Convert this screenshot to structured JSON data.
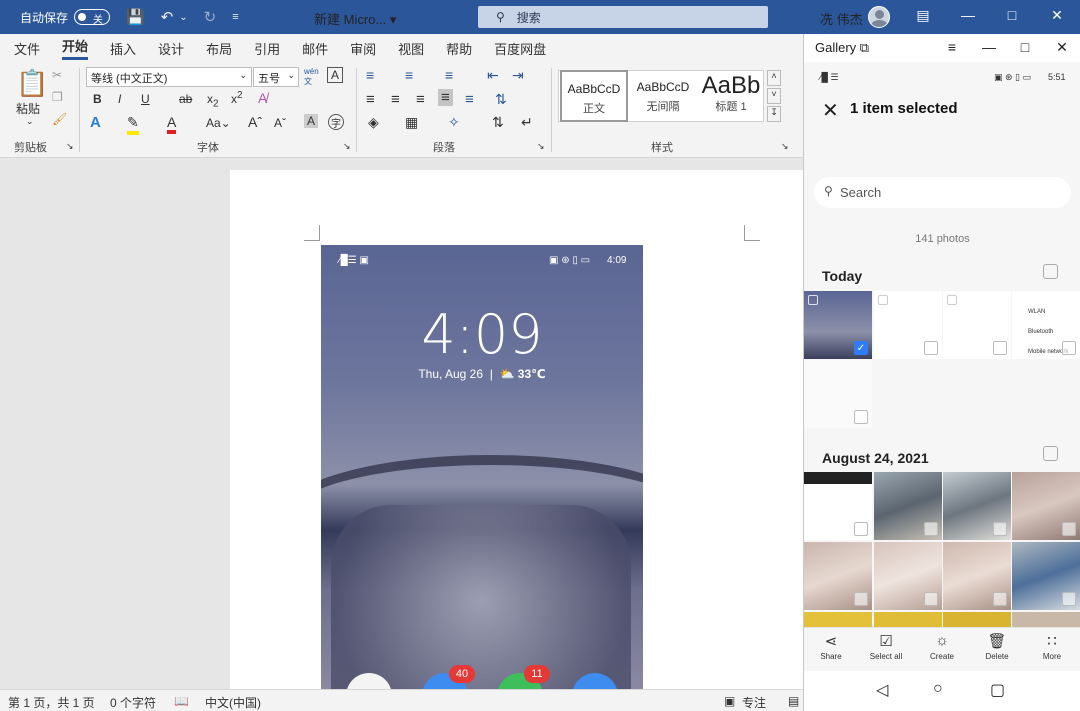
{
  "word": {
    "autosave_label": "自动保存",
    "autosave_state": "关",
    "doc_title": "新建 Micro...",
    "search_placeholder": "搜索",
    "user_name": "冼 伟杰",
    "tabs": [
      "文件",
      "开始",
      "插入",
      "设计",
      "布局",
      "引用",
      "邮件",
      "审阅",
      "视图",
      "帮助",
      "百度网盘"
    ],
    "active_tab": "开始",
    "groups": {
      "clipboard": "剪贴板",
      "font": "字体",
      "paragraph": "段落",
      "styles": "样式"
    },
    "paste_label": "粘贴",
    "font_name": "等线 (中文正文)",
    "font_size": "五号",
    "styles": [
      {
        "sample": "AaBbCcD",
        "name": "正文"
      },
      {
        "sample": "AaBbCcD",
        "name": "无间隔"
      },
      {
        "sample": "AaBb",
        "name": "标题 1"
      }
    ],
    "statusbar": {
      "page": "第 1 页，共 1 页",
      "words": "0 个字符",
      "language": "中文(中国)",
      "focus": "专注"
    }
  },
  "phone_screenshot": {
    "status_right": "4:09",
    "clock": "4:09",
    "date": "Thu, Aug 26",
    "weather": "33℃",
    "badges": [
      "40",
      "11"
    ]
  },
  "gallery": {
    "title": "Gallery",
    "status_time": "5:51",
    "selection_title": "1 item selected",
    "search_placeholder": "Search",
    "photo_count": "141 photos",
    "sections": [
      "Today",
      "August 24, 2021"
    ],
    "thumb_texts": {
      "wlan": "WLAN",
      "bluetooth": "Bluetooth",
      "mobile": "Mobile network"
    },
    "actions": [
      {
        "label": "Share",
        "icon": "share-icon"
      },
      {
        "label": "Select all",
        "icon": "select-all-icon"
      },
      {
        "label": "Create",
        "icon": "create-icon"
      },
      {
        "label": "Delete",
        "icon": "delete-icon"
      },
      {
        "label": "More",
        "icon": "more-icon"
      }
    ]
  }
}
